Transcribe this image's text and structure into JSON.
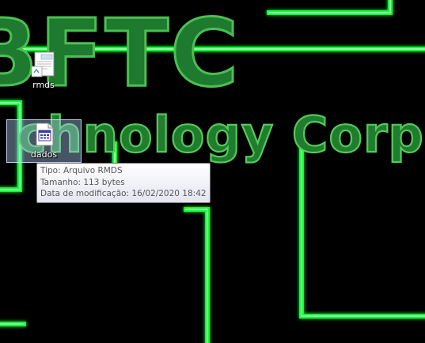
{
  "wallpaper": {
    "text_top": "BFTC",
    "text_mid": "chnology Corporat",
    "colors": {
      "background": "#000000",
      "line_glow": "#00ff22",
      "line_core": "#b8ffc0",
      "text_fill": "#1e7a2e",
      "text_edge": "#49b84f"
    }
  },
  "desktop_icons": [
    {
      "label": "rmds",
      "icon": "document-icon",
      "selected": false
    },
    {
      "label": "dados",
      "icon": "rmds-file-icon",
      "selected": true
    }
  ],
  "tooltip": {
    "type": "Tipo: Arquivo RMDS",
    "size": "Tamanho: 113 bytes",
    "modified": "Data de modificação: 16/02/2020 18:42"
  }
}
